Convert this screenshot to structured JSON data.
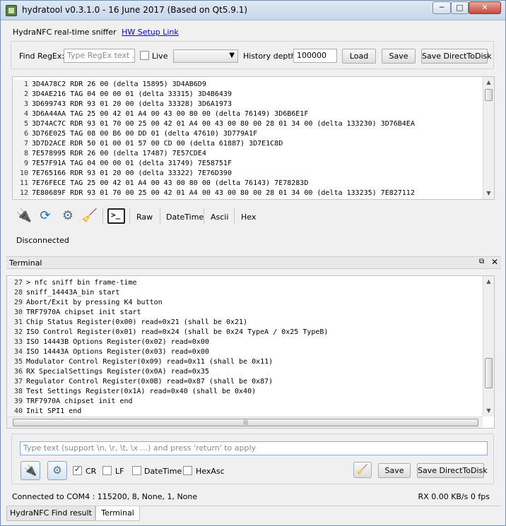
{
  "window": {
    "title": "hydratool v0.3.1.0 - 16 June 2017 (Based on Qt5.9.1)",
    "minimize": "─",
    "maximize": "□",
    "close": "✕"
  },
  "header": {
    "sniffer_label": "HydraNFC real-time sniffer",
    "hw_link": "HW Setup Link"
  },
  "filter": {
    "find_regex_label": "Find RegEx:",
    "find_regex_placeholder": "Type RegEx text ...",
    "live_label": "Live",
    "live_checked": false,
    "history_selected": "",
    "history_depth_label": "History depth:",
    "history_depth_value": "100000",
    "load_button": "Load",
    "save_button": "Save",
    "save_direct_button": "Save DirectToDisk"
  },
  "log": {
    "lines": [
      {
        "n": "1",
        "text": "3D4A78C2 RDR 26 00 (delta 15895) 3D4AB6D9"
      },
      {
        "n": "2",
        "text": "3D4AE216 TAG 04 00 00 01 (delta 33315) 3D4B6439"
      },
      {
        "n": "3",
        "text": "3D699743 RDR 93 01 20 00 (delta 33328) 3D6A1973"
      },
      {
        "n": "4",
        "text": "3D6A44AA TAG 25 00 42 01 A4 00 43 00 80 00 (delta 76149) 3D6B6E1F"
      },
      {
        "n": "5",
        "text": "3D74AC7C RDR 93 01 70 00 25 00 42 01 A4 00 43 00 80 00 28 01 34 00 (delta 133230) 3D76B4EA"
      },
      {
        "n": "6",
        "text": "3D76E025 TAG 08 00 B6 00 DD 01 (delta 47610) 3D779A1F"
      },
      {
        "n": "7",
        "text": "3D7D2ACE RDR 50 01 00 01 57 00 CD 00 (delta 61887) 3D7E1C8D"
      },
      {
        "n": "8",
        "text": "7E578995 RDR 26 00 (delta 17487) 7E57CDE4"
      },
      {
        "n": "9",
        "text": "7E57F91A TAG 04 00 00 01 (delta 31749) 7E58751F"
      },
      {
        "n": "10",
        "text": "7E765166 RDR 93 01 20 00 (delta 33322) 7E76D390"
      },
      {
        "n": "11",
        "text": "7E76FECE TAG 25 00 42 01 A4 00 43 00 80 00 (delta 76143) 7E78283D"
      },
      {
        "n": "12",
        "text": "7E80689F RDR 93 01 70 00 25 00 42 01 A4 00 43 00 80 00 28 01 34 00 (delta 133235) 7E827112"
      }
    ]
  },
  "toolbar": {
    "icons": [
      "usb-connect-icon",
      "refresh-icon",
      "settings-gear-icon",
      "broom-clear-icon",
      "terminal-icon"
    ],
    "terminal_glyph": ">_",
    "raw_label": "Raw",
    "datetime_label": "DateTime",
    "ascii_label": "Ascii",
    "hex_label": "Hex"
  },
  "connection_status": "Disconnected",
  "terminal": {
    "dock_title": "Terminal",
    "lines": [
      {
        "n": "27",
        "text": "> nfc sniff bin frame-time"
      },
      {
        "n": "28",
        "text": "sniff_14443A_bin start"
      },
      {
        "n": "29",
        "text": "Abort/Exit by pressing K4 button"
      },
      {
        "n": "30",
        "text": "TRF7970A chipset init start"
      },
      {
        "n": "31",
        "text": "Chip Status Register(0x00) read=0x21 (shall be 0x21)"
      },
      {
        "n": "32",
        "text": "ISO Control Register(0x01) read=0x24 (shall be 0x24 TypeA / 0x25 TypeB)"
      },
      {
        "n": "33",
        "text": "ISO 14443B Options Register(0x02) read=0x00"
      },
      {
        "n": "34",
        "text": "ISO 14443A Options Register(0x03) read=0x00"
      },
      {
        "n": "35",
        "text": "Modulator Control Register(0x09) read=0x11 (shall be 0x11)"
      },
      {
        "n": "36",
        "text": "RX SpecialSettings Register(0x0A) read=0x35"
      },
      {
        "n": "37",
        "text": "Regulator Control Register(0x0B) read=0x87 (shall be 0x87)"
      },
      {
        "n": "38",
        "text": "Test Settings Register(0x1A) read=0x40 (shall be 0x40)"
      },
      {
        "n": "39",
        "text": "TRF7970A chipset init end"
      },
      {
        "n": "40",
        "text": "Init SPI1 end"
      }
    ],
    "hscroll_grip": "|||"
  },
  "send": {
    "placeholder": "Type text (support \\n, \\r, \\t, \\x ...) and press 'return' to apply",
    "cr_label": "CR",
    "cr_checked": true,
    "lf_label": "LF",
    "lf_checked": false,
    "datetime_label": "DateTime",
    "datetime_checked": false,
    "hexasc_label": "HexAsc",
    "hexasc_checked": false,
    "save_button": "Save",
    "save_direct_button": "Save DirectToDisk"
  },
  "statusbar": {
    "connection": "Connected to COM4 : 115200, 8, None, 1, None",
    "rate": "RX 0.00 KB/s 0 fps"
  },
  "tabs": [
    {
      "label": "HydraNFC Find result",
      "active": false
    },
    {
      "label": "Terminal",
      "active": true
    }
  ],
  "icons": {
    "usb": "🔌",
    "refresh": "⟳",
    "gear": "⚙",
    "broom": "🧹",
    "up": "▲",
    "down": "▼",
    "float": "⧉",
    "close": "✕"
  }
}
